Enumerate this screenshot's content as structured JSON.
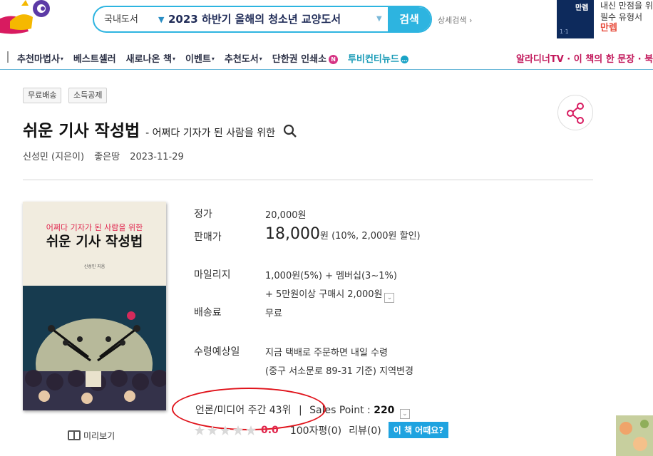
{
  "header": {
    "search": {
      "category": "국내도서",
      "query": "2023 하반기 올해의 청소년 교양도서",
      "button": "검색",
      "advanced": "상세검색 ›"
    },
    "ad": {
      "book_label": "만렙",
      "line1": "내신 만점을 위한",
      "line2": "필수 유형서",
      "line3": "만렙"
    }
  },
  "nav": {
    "items": [
      {
        "label": "추천마법사",
        "arrow": "▾"
      },
      {
        "label": "베스트셀러",
        "arrow": ""
      },
      {
        "label": "새로나온 책",
        "arrow": "▾"
      },
      {
        "label": "이벤트",
        "arrow": "▾"
      },
      {
        "label": "추천도서",
        "arrow": "▾"
      },
      {
        "label": "단한권 인쇄소",
        "arrow": ""
      },
      {
        "label": "투비컨티뉴드",
        "arrow": ""
      }
    ],
    "badge_n": "N",
    "badge_dot": "…",
    "right": "알라디너TV · 이 책의 한 문장 · 북"
  },
  "tags": [
    "무료배송",
    "소득공제"
  ],
  "book": {
    "title": "쉬운 기사 작성법",
    "subtitle": "- 어쩌다 기자가 된 사람을 위한",
    "author": "신성민 (지은이)",
    "publisher": "좋은땅",
    "date": "2023-11-29",
    "cover": {
      "subtitle": "어쩌다 기자가 된 사람을 위한",
      "title": "쉬운 기사 작성법",
      "author": "신성민 지음",
      "publisher_mark": "좋은땅"
    },
    "preview": "미리보기"
  },
  "info": {
    "list_price_label": "정가",
    "list_price": "20,000원",
    "sale_price_label": "판매가",
    "sale_price": "18,000",
    "sale_price_unit": "원",
    "sale_note": "(10%, 2,000원 할인)",
    "mileage_label": "마일리지",
    "mileage_line1": "1,000원(5%) + 멤버십(3~1%)",
    "mileage_line2": "+ 5만원이상 구매시 2,000원",
    "shipping_label": "배송료",
    "shipping": "무료",
    "delivery_label": "수령예상일",
    "delivery_line1": "지금 택배로 주문하면 내일 수령",
    "delivery_line2": "(중구 서소문로 89-31 기준) 지역변경",
    "rank": "언론/미디어 주간 43위",
    "separator": "|",
    "sales_point_label": "Sales Point : ",
    "sales_point": "220",
    "rating": 0.0,
    "score": "0.0",
    "reviews_100": "100자평(0)",
    "reviews": "리뷰(0)",
    "review_button": "이 책 어때요?"
  },
  "colors": {
    "accent": "#2db4e0",
    "highlight_circle": "#e0131b",
    "score_red": "#e0244c"
  }
}
